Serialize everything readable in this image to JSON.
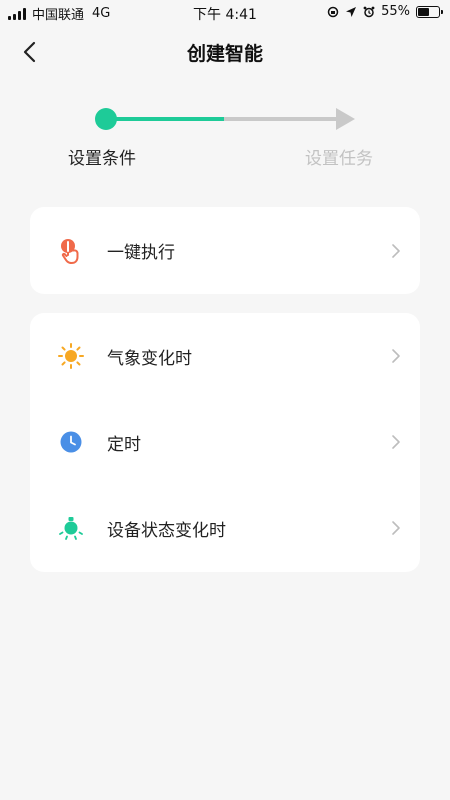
{
  "status_bar": {
    "carrier": "中国联通",
    "network": "4G",
    "time": "下午 4:41",
    "battery": "55%",
    "battery_level": 0.55
  },
  "nav": {
    "title": "创建智能",
    "back_icon": "chevron-left-icon"
  },
  "steps": {
    "step1_label": "设置条件",
    "step2_label": "设置任务",
    "active_color": "#1ecb98",
    "inactive_color": "#c9c9c9"
  },
  "cards": [
    {
      "rows": [
        {
          "label": "一键执行",
          "icon": "tap-hand-icon"
        }
      ]
    },
    {
      "rows": [
        {
          "label": "气象变化时",
          "icon": "sun-icon"
        },
        {
          "label": "定时",
          "icon": "clock-icon"
        },
        {
          "label": "设备状态变化时",
          "icon": "device-bulb-icon"
        }
      ]
    }
  ],
  "colors": {
    "tap": "#f06a4a",
    "sun": "#f7a823",
    "clock": "#4a8fe6",
    "device": "#1ecb98"
  }
}
